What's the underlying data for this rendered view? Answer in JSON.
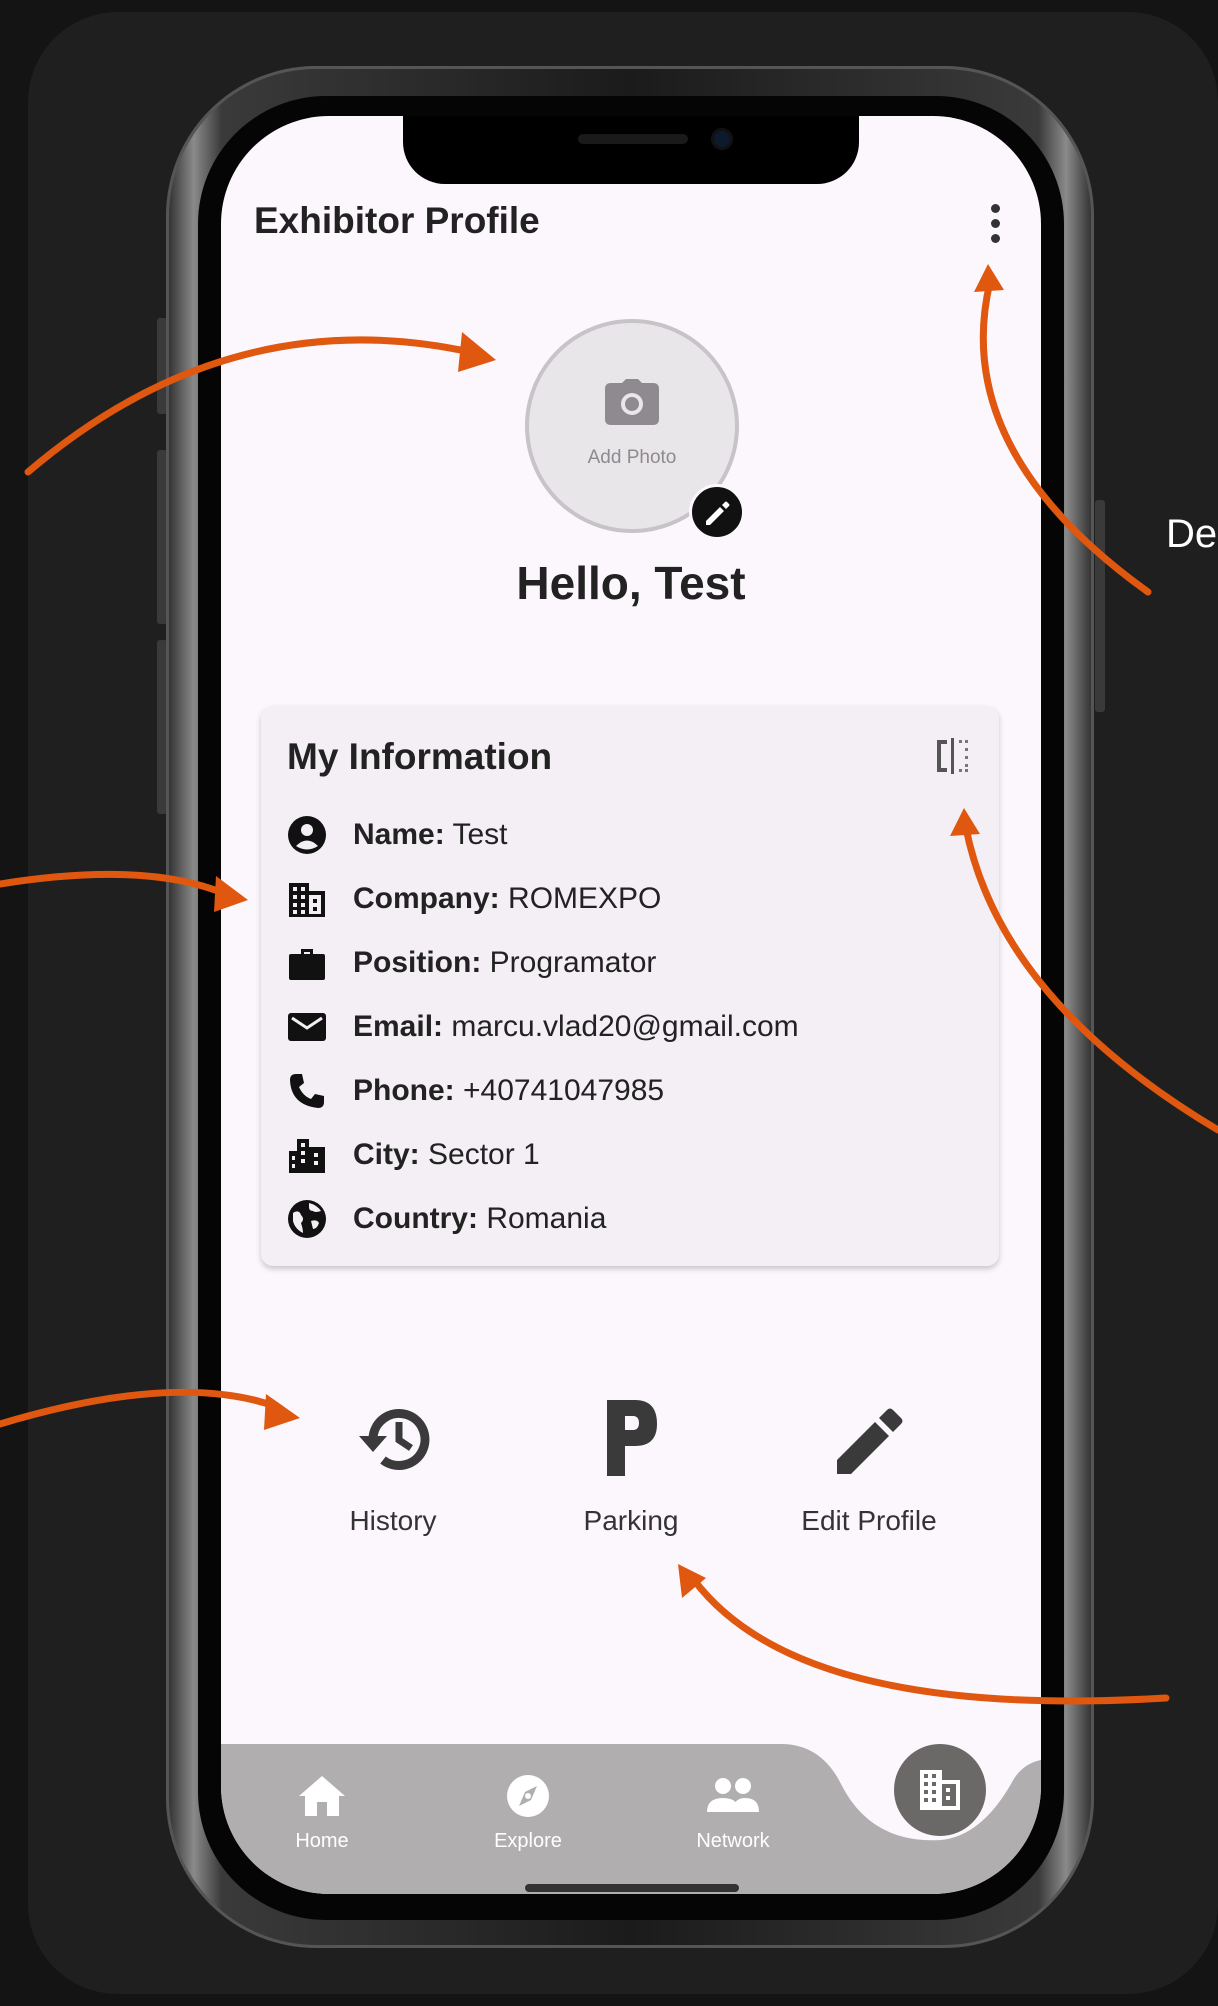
{
  "app": {
    "title": "Exhibitor Profile",
    "greeting": "Hello, Test",
    "add_photo_label": "Add Photo"
  },
  "info_card": {
    "title": "My Information",
    "rows": [
      {
        "icon": "account-circle-icon",
        "label": "Name:",
        "value": "Test"
      },
      {
        "icon": "business-icon",
        "label": "Company:",
        "value": "ROMEXPO"
      },
      {
        "icon": "work-icon",
        "label": "Position:",
        "value": "Programator"
      },
      {
        "icon": "email-icon",
        "label": "Email:",
        "value": "marcu.vlad20@gmail.com"
      },
      {
        "icon": "phone-icon",
        "label": "Phone:",
        "value": "+40741047985"
      },
      {
        "icon": "location-city-icon",
        "label": "City:",
        "value": "Sector 1"
      },
      {
        "icon": "public-icon",
        "label": "Country:",
        "value": "Romania"
      }
    ]
  },
  "actions": [
    {
      "icon": "history-icon",
      "label": "History"
    },
    {
      "icon": "parking-icon",
      "label": "Parking"
    },
    {
      "icon": "edit-icon",
      "label": "Edit Profile"
    }
  ],
  "bottom_nav": [
    {
      "icon": "home-icon",
      "label": "Home"
    },
    {
      "icon": "explore-icon",
      "label": "Explore"
    },
    {
      "icon": "network-icon",
      "label": "Network"
    }
  ],
  "annotation": {
    "side_text": "De"
  },
  "colors": {
    "arrow": "#e0570f",
    "screen_bg": "#fbf7fc",
    "nav_bg": "#b1aeaf",
    "fab_bg": "#6b6868"
  }
}
